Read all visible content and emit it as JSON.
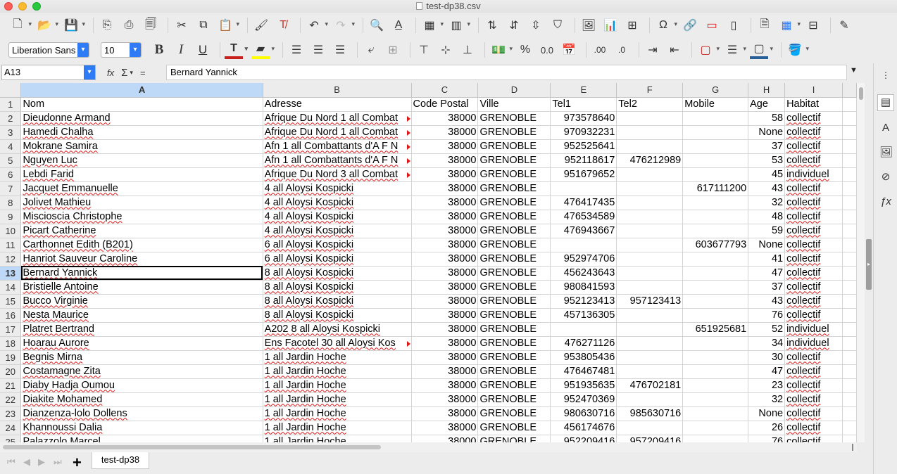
{
  "window": {
    "title": "test-dp38.csv"
  },
  "toolbar1": {
    "icons": [
      "new-icon",
      "open-icon",
      "save-icon",
      "export-pdf-icon",
      "print-icon",
      "print-preview-icon",
      "cut-icon",
      "copy-icon",
      "paste-icon",
      "clone-formatting-icon",
      "clear-formatting-icon",
      "undo-icon",
      "redo-icon",
      "find-replace-icon",
      "spelling-icon",
      "row-icon",
      "column-icon",
      "sort-ascending-icon",
      "sort-descending-icon",
      "sort-icon",
      "autofilter-icon",
      "image-icon",
      "chart-icon",
      "pivot-table-icon",
      "special-character-icon",
      "hyperlink-icon",
      "comment-icon",
      "headers-footers-icon",
      "define-print-area-icon",
      "freeze-icon",
      "split-window-icon",
      "show-draw-functions-icon"
    ]
  },
  "toolbar2": {
    "font_name": "Liberation Sans",
    "font_size": "10",
    "bold": "B",
    "italic": "I",
    "underline": "U",
    "percent": "%",
    "decimal": "0.0",
    "add_decimal": ".00",
    "del_decimal": ".0"
  },
  "formula_bar": {
    "name_box": "A13",
    "fx": "fx",
    "sum": "Σ",
    "equals": "=",
    "content": "Bernard Yannick"
  },
  "columns": [
    "A",
    "B",
    "C",
    "D",
    "E",
    "F",
    "G",
    "H",
    "I"
  ],
  "selected_column": "A",
  "active_row": 13,
  "rows": [
    {
      "n": "1",
      "c": [
        "Nom",
        "Adresse",
        "Code Postal",
        "Ville",
        "Tel1",
        "Tel2",
        "Mobile",
        "Age",
        "Habitat"
      ]
    },
    {
      "n": "2",
      "c": [
        "Dieudonne Armand",
        "Afrique Du Nord 1 all Combat",
        "38000",
        "GRENOBLE",
        "973578640",
        "",
        "",
        "58",
        "collectif"
      ]
    },
    {
      "n": "3",
      "c": [
        "Hamedi Chalha",
        "Afrique Du Nord 1 all Combat",
        "38000",
        "GRENOBLE",
        "970932231",
        "",
        "",
        "None",
        "collectif"
      ]
    },
    {
      "n": "4",
      "c": [
        "Mokrane Samira",
        "Afn 1 all Combattants d'A F N",
        "38000",
        "GRENOBLE",
        "952525641",
        "",
        "",
        "37",
        "collectif"
      ]
    },
    {
      "n": "5",
      "c": [
        "Nguyen Luc",
        "Afn 1 all Combattants d'A F N",
        "38000",
        "GRENOBLE",
        "952118617",
        "476212989",
        "",
        "53",
        "collectif"
      ]
    },
    {
      "n": "6",
      "c": [
        "Lebdi Farid",
        "Afrique Du Nord 3 all Combat",
        "38000",
        "GRENOBLE",
        "951679652",
        "",
        "",
        "45",
        "individuel"
      ]
    },
    {
      "n": "7",
      "c": [
        "Jacquet Emmanuelle",
        "4 all Aloysi Kospicki",
        "38000",
        "GRENOBLE",
        "",
        "",
        "617111200",
        "43",
        "collectif"
      ]
    },
    {
      "n": "8",
      "c": [
        "Jolivet Mathieu",
        "4 all Aloysi Kospicki",
        "38000",
        "GRENOBLE",
        "476417435",
        "",
        "",
        "32",
        "collectif"
      ]
    },
    {
      "n": "9",
      "c": [
        "Miscioscia Christophe",
        "4 all Aloysi Kospicki",
        "38000",
        "GRENOBLE",
        "476534589",
        "",
        "",
        "48",
        "collectif"
      ]
    },
    {
      "n": "10",
      "c": [
        "Picart Catherine",
        "4 all Aloysi Kospicki",
        "38000",
        "GRENOBLE",
        "476943667",
        "",
        "",
        "59",
        "collectif"
      ]
    },
    {
      "n": "11",
      "c": [
        "Carthonnet Edith (B201)",
        "6 all Aloysi Kospicki",
        "38000",
        "GRENOBLE",
        "",
        "",
        "603677793",
        "None",
        "collectif"
      ]
    },
    {
      "n": "12",
      "c": [
        "Hanriot Sauveur Caroline",
        "6 all Aloysi Kospicki",
        "38000",
        "GRENOBLE",
        "952974706",
        "",
        "",
        "41",
        "collectif"
      ]
    },
    {
      "n": "13",
      "c": [
        "Bernard Yannick",
        "8 all Aloysi Kospicki",
        "38000",
        "GRENOBLE",
        "456243643",
        "",
        "",
        "47",
        "collectif"
      ]
    },
    {
      "n": "14",
      "c": [
        "Bristielle Antoine",
        "8 all Aloysi Kospicki",
        "38000",
        "GRENOBLE",
        "980841593",
        "",
        "",
        "37",
        "collectif"
      ]
    },
    {
      "n": "15",
      "c": [
        "Bucco Virginie",
        "8 all Aloysi Kospicki",
        "38000",
        "GRENOBLE",
        "952123413",
        "957123413",
        "",
        "43",
        "collectif"
      ]
    },
    {
      "n": "16",
      "c": [
        "Nesta Maurice",
        "8 all Aloysi Kospicki",
        "38000",
        "GRENOBLE",
        "457136305",
        "",
        "",
        "76",
        "collectif"
      ]
    },
    {
      "n": "17",
      "c": [
        "Platret Bertrand",
        "A202 8 all Aloysi Kospicki",
        "38000",
        "GRENOBLE",
        "",
        "",
        "651925681",
        "52",
        "individuel"
      ]
    },
    {
      "n": "18",
      "c": [
        "Hoarau Aurore",
        "Ens Facotel 30 all Aloysi Kos",
        "38000",
        "GRENOBLE",
        "476271126",
        "",
        "",
        "34",
        "individuel"
      ]
    },
    {
      "n": "19",
      "c": [
        "Begnis Mirna",
        "1 all Jardin Hoche",
        "38000",
        "GRENOBLE",
        "953805436",
        "",
        "",
        "30",
        "collectif"
      ]
    },
    {
      "n": "20",
      "c": [
        "Costamagne Zita",
        "1 all Jardin Hoche",
        "38000",
        "GRENOBLE",
        "476467481",
        "",
        "",
        "47",
        "collectif"
      ]
    },
    {
      "n": "21",
      "c": [
        "Diaby Hadja Oumou",
        "1 all Jardin Hoche",
        "38000",
        "GRENOBLE",
        "951935635",
        "476702181",
        "",
        "23",
        "collectif"
      ]
    },
    {
      "n": "22",
      "c": [
        "Diakite Mohamed",
        "1 all Jardin Hoche",
        "38000",
        "GRENOBLE",
        "952470369",
        "",
        "",
        "32",
        "collectif"
      ]
    },
    {
      "n": "23",
      "c": [
        "Dianzenza-lolo Dollens",
        "1 all Jardin Hoche",
        "38000",
        "GRENOBLE",
        "980630716",
        "985630716",
        "",
        "None",
        "collectif"
      ]
    },
    {
      "n": "24",
      "c": [
        "Khannoussi Dalia",
        "1 all Jardin Hoche",
        "38000",
        "GRENOBLE",
        "456174676",
        "",
        "",
        "26",
        "collectif"
      ]
    },
    {
      "n": "25",
      "c": [
        "Palazzolo Marcel",
        "1 all Jardin Hoche",
        "38000",
        "GRENOBLE",
        "952209416",
        "957209416",
        "",
        "76",
        "collectif"
      ]
    }
  ],
  "sheet_tabs": {
    "add": "+",
    "active": "test-dp38"
  },
  "sidebar": [
    "properties-icon",
    "styles-icon",
    "gallery-icon",
    "navigator-icon",
    "functions-icon"
  ]
}
